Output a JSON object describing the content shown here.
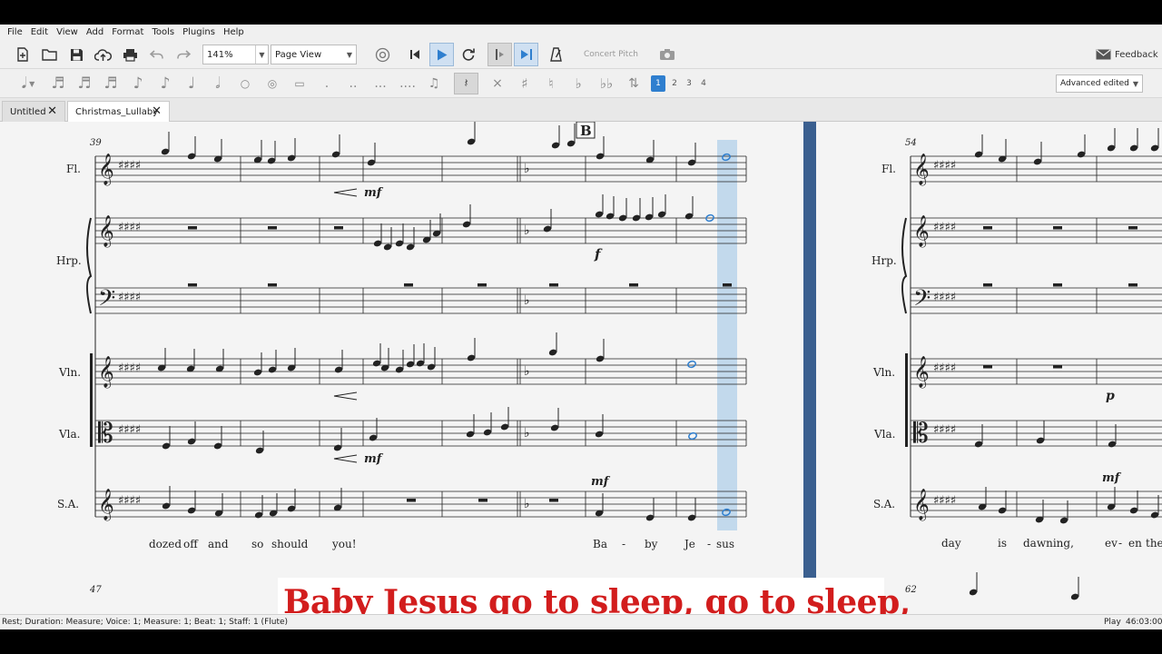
{
  "menu": [
    "File",
    "Edit",
    "View",
    "Add",
    "Format",
    "Tools",
    "Plugins",
    "Help"
  ],
  "toolbar": {
    "zoom_value": "141%",
    "view_mode": "Page View",
    "concert_pitch": "Concert Pitch",
    "feedback": "Feedback"
  },
  "note_input": {
    "voices": [
      "1",
      "2",
      "3",
      "4"
    ],
    "workspace": "Advanced edited"
  },
  "tabs": [
    {
      "label": "Untitled"
    },
    {
      "label": "Christmas_Lullaby"
    }
  ],
  "score": {
    "rehearsal_mark": "B",
    "measure_numbers": [
      "39",
      "54",
      "47",
      "62"
    ],
    "instruments": [
      "Fl.",
      "Hrp.",
      "Vln.",
      "Vla.",
      "S.A."
    ],
    "dynamics": {
      "mf": "mf",
      "f": "f",
      "p": "p"
    },
    "lyrics_left": [
      "dozed",
      "off",
      "and",
      "so",
      "should",
      "you!",
      "Ba",
      "-",
      "by",
      "Je",
      "-",
      "sus"
    ],
    "lyrics_right": [
      "day",
      "is",
      "dawning,",
      "ev",
      "-",
      "en",
      "the"
    ]
  },
  "status": {
    "left": "Rest; Duration: Measure; Voice: 1;  Measure: 1; Beat: 1; Staff: 1 (Flute)",
    "mode": "Play",
    "time": "46:03:000"
  },
  "caption": "Baby Jesus go to sleep, go to sleep,",
  "colors": {
    "accent": "#2f7fcf",
    "selection": "#b8d3ea",
    "page_divider": "#3a5f8f",
    "caption": "#d21d1d"
  }
}
